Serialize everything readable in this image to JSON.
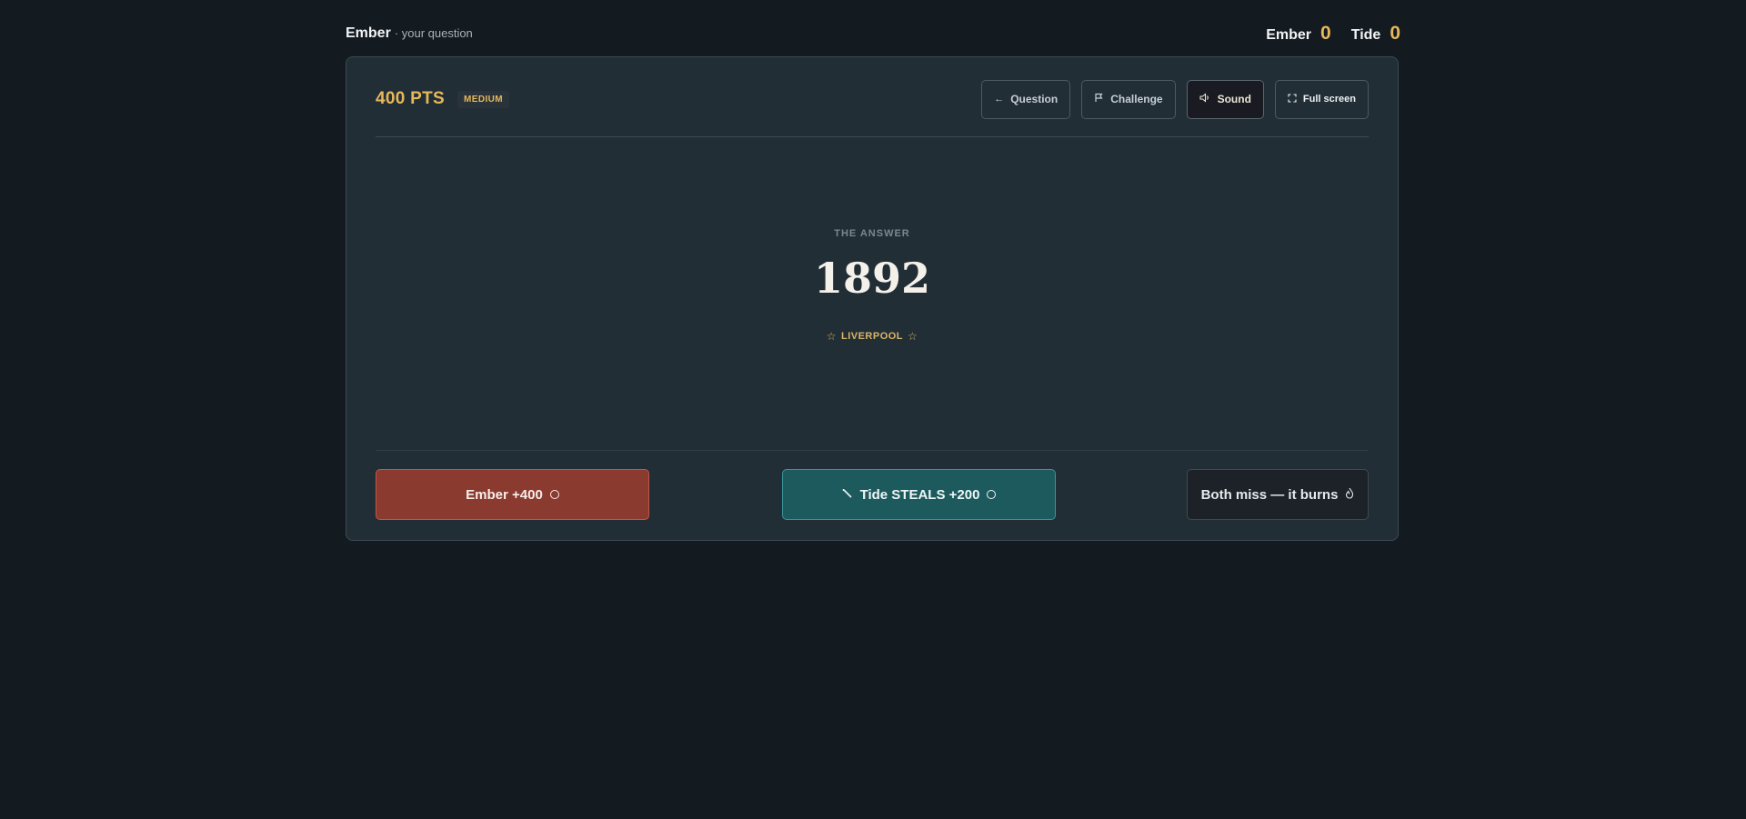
{
  "topbar": {
    "turn_team": "Ember",
    "turn_sub": "· your question",
    "scores": [
      {
        "name": "Ember",
        "value": "0"
      },
      {
        "name": "Tide",
        "value": "0"
      }
    ]
  },
  "card": {
    "points": "400 PTS",
    "difficulty": "MEDIUM",
    "toolbar": {
      "question": "Question",
      "challenge": "Challenge",
      "sound": "Sound",
      "fullscreen": "Full screen"
    },
    "answer_label": "THE ANSWER",
    "answer_value": "1892",
    "location": "LIVERPOOL",
    "actions": {
      "ember": "Ember +400",
      "tide": "Tide STEALS +200",
      "miss": "Both miss — it burns"
    }
  },
  "colors": {
    "background": "#131a20",
    "card": "#222e36",
    "gold": "#e7b85a",
    "ember": "#8b3a30",
    "tide": "#1d5a5e"
  },
  "icons": {
    "question": "arrow-left-icon",
    "challenge": "flag-icon",
    "sound": "speaker-icon",
    "fullscreen": "expand-icon",
    "location": "star-icon",
    "ember": "circle-icon",
    "tide_lead": "wand-icon",
    "tide_trail": "circle-icon",
    "miss": "flame-icon"
  }
}
